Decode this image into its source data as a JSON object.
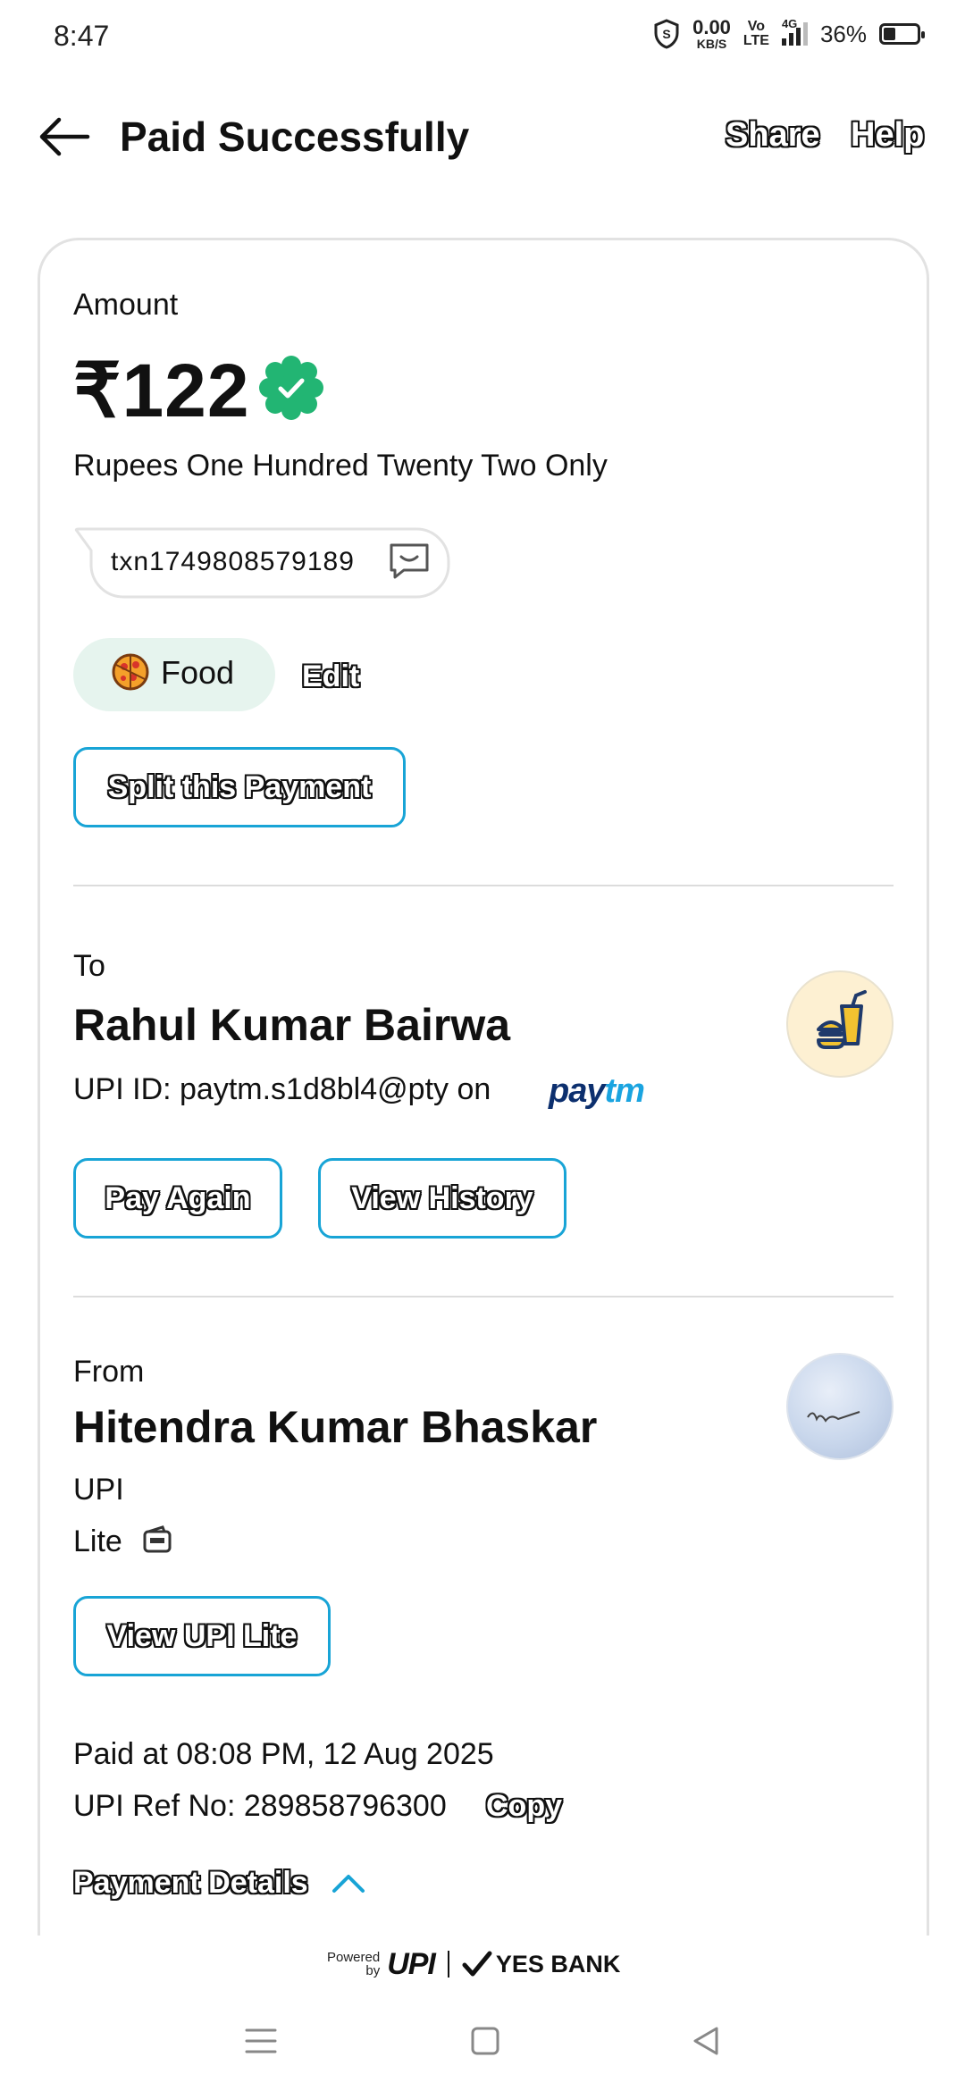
{
  "status": {
    "time": "8:47",
    "speed_value": "0.00",
    "speed_unit": "KB/S",
    "volte_top": "Vo",
    "volte_bottom": "LTE",
    "network": "4G",
    "battery": "36%",
    "battery_level": 0.36
  },
  "header": {
    "title": "Paid Successfully",
    "share": "Share",
    "help": "Help"
  },
  "payment": {
    "amount_label": "Amount",
    "amount": "₹122",
    "amount_words": "Rupees One Hundred Twenty Two Only",
    "note": "txn1749808579189",
    "category": "Food",
    "edit": "Edit",
    "split_button": "Split this Payment"
  },
  "to": {
    "label": "To",
    "name": "Rahul Kumar Bairwa",
    "upi_text": "UPI ID: paytm.s1d8bl4@pty on",
    "paytm_pay": "pay",
    "paytm_tm": "tm",
    "pay_again": "Pay Again",
    "view_history": "View History"
  },
  "from": {
    "label": "From",
    "name": "Hitendra Kumar Bhaskar",
    "line1": "UPI",
    "line2": "Lite",
    "view_lite": "View UPI Lite"
  },
  "details": {
    "paid_at": "Paid at 08:08 PM, 12 Aug 2025",
    "ref": "UPI Ref No: 289858796300",
    "copy": "Copy",
    "payment_details": "Payment Details"
  },
  "footer": {
    "powered": "Powered",
    "by": "by",
    "upi": "UPI",
    "bank": "YES BANK"
  },
  "colors": {
    "accent": "#18a4d6",
    "verified": "#22b573",
    "category_bg": "#e6f4ee"
  }
}
